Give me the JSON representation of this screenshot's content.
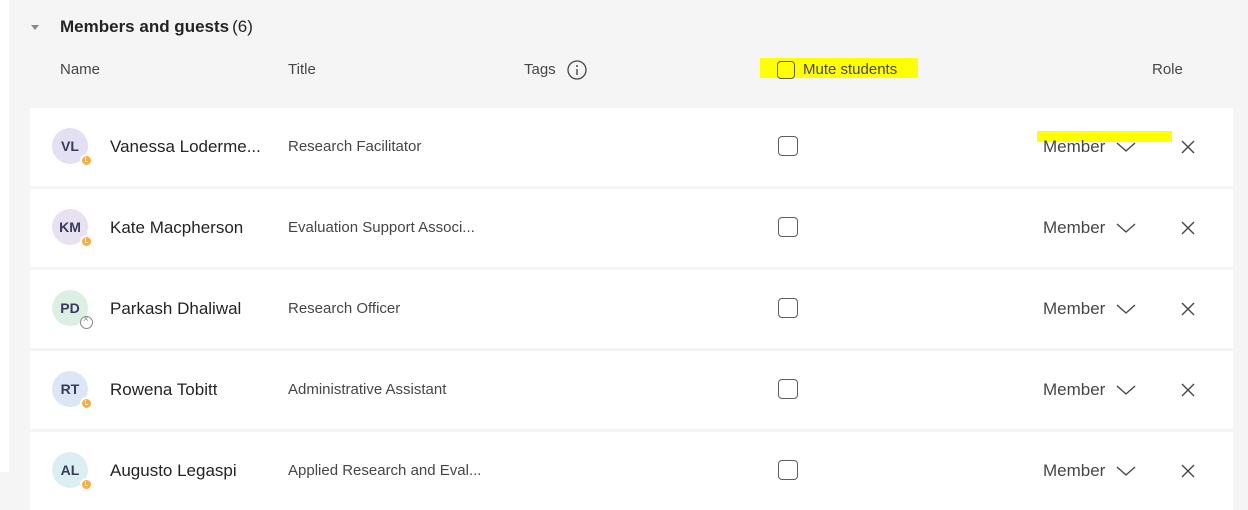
{
  "section": {
    "title": "Members and guests",
    "count": "(6)"
  },
  "columns": {
    "name": "Name",
    "title": "Title",
    "tags": "Tags",
    "mute": "Mute students",
    "role": "Role"
  },
  "members": [
    {
      "initials": "VL",
      "name": "Vanessa Loderme...",
      "title": "Research Facilitator",
      "role": "Member",
      "presence": "away",
      "avatar_color": "#e3e0f4"
    },
    {
      "initials": "KM",
      "name": "Kate Macpherson",
      "title": "Evaluation Support Associ...",
      "role": "Member",
      "presence": "away",
      "avatar_color": "#e8e1f2"
    },
    {
      "initials": "PD",
      "name": "Parkash Dhaliwal",
      "title": "Research Officer",
      "role": "Member",
      "presence": "offline",
      "avatar_color": "#dcefe3"
    },
    {
      "initials": "RT",
      "name": "Rowena Tobitt",
      "title": "Administrative Assistant",
      "role": "Member",
      "presence": "away",
      "avatar_color": "#dde6f4"
    },
    {
      "initials": "AL",
      "name": "Augusto Legaspi",
      "title": "Applied Research and Eval...",
      "role": "Member",
      "presence": "away",
      "avatar_color": "#dbeff3"
    }
  ],
  "colors": {
    "highlight": "#ffff00",
    "away_status": "#ffaa44",
    "row_background": "#ffffff",
    "page_background": "#f5f5f5"
  },
  "icons": {
    "collapse": "caret-down-icon",
    "info": "info-icon",
    "chevron": "chevron-down-icon",
    "remove": "close-icon",
    "away": "clock-status-icon",
    "offline": "offline-status-icon"
  }
}
